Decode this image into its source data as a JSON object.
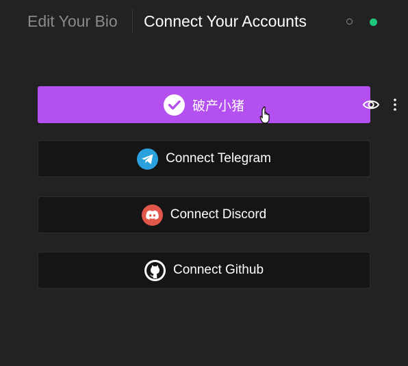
{
  "header": {
    "tabs": [
      {
        "label": "Edit Your Bio",
        "active": false
      },
      {
        "label": "Connect Your Accounts",
        "active": true
      }
    ],
    "status_dots": [
      "empty-dot",
      "green-dot"
    ]
  },
  "accounts": [
    {
      "label": "破产小猪",
      "icon": "check-circle-icon",
      "connected": true,
      "color": "#b44ff0"
    },
    {
      "label": "Connect Telegram",
      "icon": "telegram-icon",
      "connected": false,
      "color": "#2aa1dc"
    },
    {
      "label": "Connect Discord",
      "icon": "discord-icon",
      "connected": false,
      "color": "#e0574a"
    },
    {
      "label": "Connect Github",
      "icon": "github-icon",
      "connected": false,
      "color": "#ffffff"
    }
  ],
  "colors": {
    "background": "#222222",
    "accent": "#b44ff0",
    "status_green": "#1ec77a"
  }
}
